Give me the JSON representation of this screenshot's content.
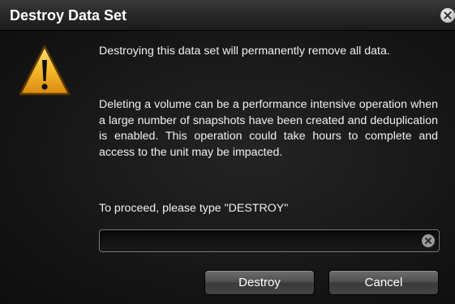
{
  "dialog": {
    "title": "Destroy Data Set",
    "close_icon": "close-circle-icon",
    "warning_icon": "warning-triangle-icon",
    "message_primary": "Destroying this data set will permanently remove all data.",
    "message_secondary": "Deleting a volume can be a performance intensive operation when a large number of snapshots have been created and deduplication is enabled. This operation could take hours to complete and access to the unit may be impacted.",
    "prompt": "To proceed, please type \"DESTROY\"",
    "confirm_input": {
      "value": "",
      "placeholder": "",
      "clear_icon": "clear-circle-icon"
    },
    "buttons": {
      "destroy_label": "Destroy",
      "cancel_label": "Cancel"
    }
  },
  "colors": {
    "background": "#161616",
    "titlebar": "#262626",
    "text": "#f0f0f0",
    "warning_fill": "#f5b829",
    "button": "#4e4e4e"
  }
}
